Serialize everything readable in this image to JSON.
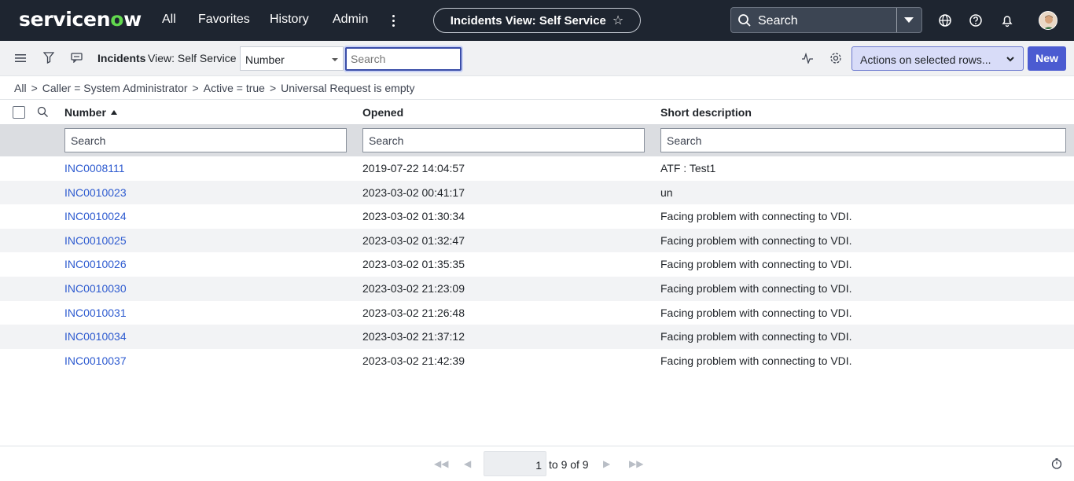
{
  "nav": {
    "logo_prefix": "servicen",
    "logo_o": "o",
    "logo_suffix": "w",
    "links": [
      "All",
      "Favorites",
      "History",
      "Admin"
    ],
    "page_title": "Incidents View: Self Service",
    "search_label": "Search",
    "brand_green": "#62d84e",
    "nav_bg": "#1e2530"
  },
  "toolbar": {
    "list_title": "Incidents",
    "view_label": "View: Self Service",
    "field_select_value": "Number",
    "search_placeholder": "Search",
    "actions_label": "Actions on selected rows...",
    "new_label": "New",
    "accent": "#4b5bd1"
  },
  "breadcrumb": [
    "All",
    "Caller = System Administrator",
    "Active = true",
    "Universal Request is empty"
  ],
  "table": {
    "columns": [
      "Number",
      "Opened",
      "Short description"
    ],
    "sort_column": "Number",
    "column_search_placeholder": "Search",
    "rows": [
      {
        "number": "INC0008111",
        "opened": "2019-07-22 14:04:57",
        "desc": "ATF : Test1"
      },
      {
        "number": "INC0010023",
        "opened": "2023-03-02 00:41:17",
        "desc": "un"
      },
      {
        "number": "INC0010024",
        "opened": "2023-03-02 01:30:34",
        "desc": "Facing problem with connecting to VDI."
      },
      {
        "number": "INC0010025",
        "opened": "2023-03-02 01:32:47",
        "desc": "Facing problem with connecting to VDI."
      },
      {
        "number": "INC0010026",
        "opened": "2023-03-02 01:35:35",
        "desc": "Facing problem with connecting to VDI."
      },
      {
        "number": "INC0010030",
        "opened": "2023-03-02 21:23:09",
        "desc": "Facing problem with connecting to VDI."
      },
      {
        "number": "INC0010031",
        "opened": "2023-03-02 21:26:48",
        "desc": "Facing problem with connecting to VDI."
      },
      {
        "number": "INC0010034",
        "opened": "2023-03-02 21:37:12",
        "desc": "Facing problem with connecting to VDI."
      },
      {
        "number": "INC0010037",
        "opened": "2023-03-02 21:42:39",
        "desc": "Facing problem with connecting to VDI."
      }
    ]
  },
  "pagination": {
    "current": "1",
    "range_text": "to 9 of 9"
  }
}
